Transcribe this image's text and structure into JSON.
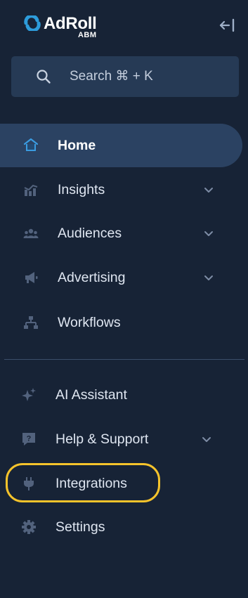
{
  "brand": {
    "name": "AdRoll",
    "sub": "ABM"
  },
  "search": {
    "placeholder": "Search ⌘ + K",
    "icon": "search-icon"
  },
  "colors": {
    "background": "#172336",
    "active": "#2b4262",
    "search_bg": "#263a55",
    "highlight": "#f5c32b",
    "accent": "#2d9cdb"
  },
  "nav": {
    "primary": [
      {
        "label": "Home",
        "icon": "home-icon",
        "active": true,
        "expandable": false
      },
      {
        "label": "Insights",
        "icon": "chart-icon",
        "active": false,
        "expandable": true
      },
      {
        "label": "Audiences",
        "icon": "people-icon",
        "active": false,
        "expandable": true
      },
      {
        "label": "Advertising",
        "icon": "megaphone-icon",
        "active": false,
        "expandable": true
      },
      {
        "label": "Workflows",
        "icon": "workflow-icon",
        "active": false,
        "expandable": false
      }
    ],
    "secondary": [
      {
        "label": "AI Assistant",
        "icon": "sparkle-icon",
        "expandable": false
      },
      {
        "label": "Help & Support",
        "icon": "help-icon",
        "expandable": true
      },
      {
        "label": "Integrations",
        "icon": "plug-icon",
        "expandable": false,
        "highlighted": true
      },
      {
        "label": "Settings",
        "icon": "gear-icon",
        "expandable": false
      }
    ]
  }
}
